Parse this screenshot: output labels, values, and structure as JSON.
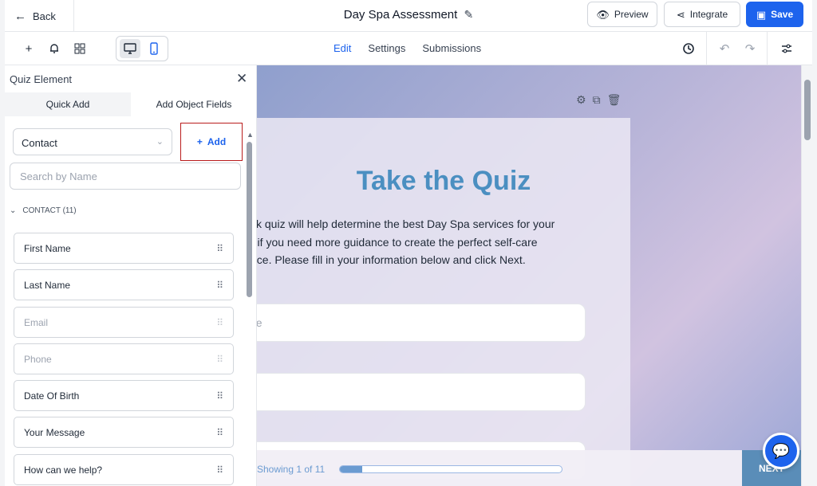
{
  "header": {
    "back_label": "Back",
    "title": "Day Spa Assessment",
    "preview_label": "Preview",
    "integrate_label": "Integrate",
    "save_label": "Save"
  },
  "toolbar": {
    "tabs": [
      {
        "label": "Edit",
        "active": true
      },
      {
        "label": "Settings",
        "active": false
      },
      {
        "label": "Submissions",
        "active": false
      }
    ],
    "selected_device": "desktop"
  },
  "panel": {
    "title": "Quiz Element",
    "tabs": [
      {
        "label": "Quick Add",
        "active": true
      },
      {
        "label": "Add Object Fields",
        "active": false
      }
    ],
    "object_select": "Contact",
    "add_label": "Add",
    "search_placeholder": "Search by Name",
    "section_label": "CONTACT (11)",
    "items": [
      {
        "label": "First Name",
        "disabled": false
      },
      {
        "label": "Last Name",
        "disabled": false
      },
      {
        "label": "Email",
        "disabled": true
      },
      {
        "label": "Phone",
        "disabled": true
      },
      {
        "label": "Date Of Birth",
        "disabled": false
      },
      {
        "label": "Your Message",
        "disabled": false
      },
      {
        "label": "How can we help?",
        "disabled": false
      }
    ]
  },
  "canvas": {
    "quiz_title": "Take the Quiz",
    "quiz_description": "ck quiz will help determine the best Day Spa services for your\nr if you need more guidance to create the perfect self-care\nnce. Please fill in your information below and click Next.",
    "field_1_placeholder": "ne",
    "required_marker": "*",
    "showing_text": "Showing 1 of 11",
    "progress_percent": 10,
    "next_label": "NEXT"
  },
  "colors": {
    "accent": "#1d63ed",
    "quiz_title": "#4b8fc1",
    "highlight_border": "#b91c1c"
  }
}
